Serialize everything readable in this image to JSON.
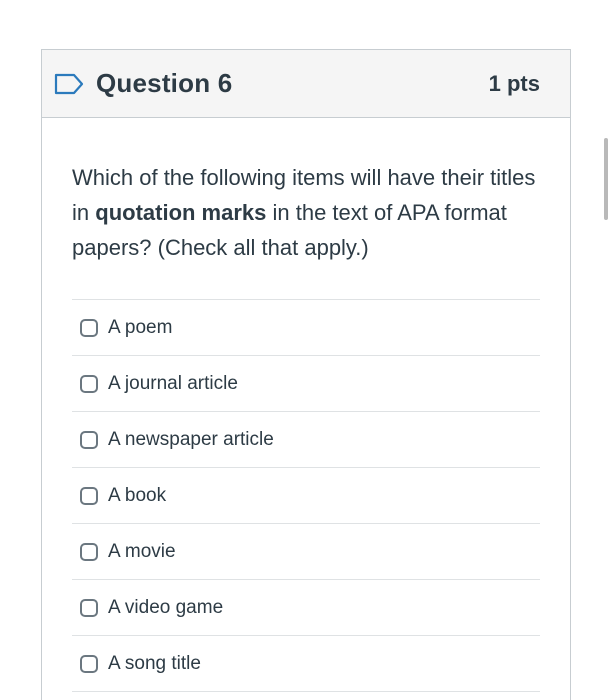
{
  "question": {
    "title": "Question 6",
    "points": "1 pts",
    "text_parts": {
      "before": "Which of the following items will have their titles in ",
      "bold": "quotation marks",
      "after": " in the text of APA format papers? (Check all that apply.)"
    },
    "answers": [
      {
        "label": "A poem",
        "checked": false
      },
      {
        "label": "A journal article",
        "checked": false
      },
      {
        "label": "A newspaper article",
        "checked": false
      },
      {
        "label": "A book",
        "checked": false
      },
      {
        "label": "A movie",
        "checked": false
      },
      {
        "label": "A video game",
        "checked": false
      },
      {
        "label": "A song title",
        "checked": false
      }
    ]
  },
  "icons": {
    "flag": "flag-bookmark-icon"
  },
  "colors": {
    "flag_outline": "#2b7abc",
    "text": "#2d3b45",
    "header_bg": "#f5f5f5",
    "border": "#c7cdd1"
  }
}
